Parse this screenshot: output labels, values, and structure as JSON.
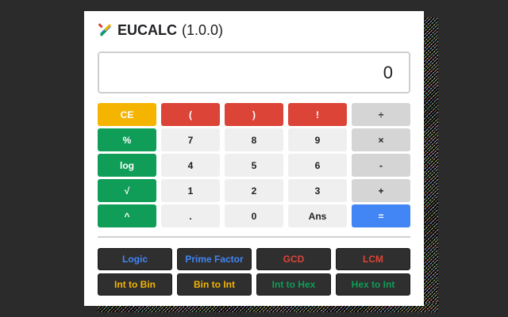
{
  "header": {
    "app_name": "EUCALC",
    "version": "(1.0.0)",
    "logo_icon": "pencil-ruler-icon"
  },
  "display": {
    "value": "0"
  },
  "keypad": {
    "rows": [
      [
        {
          "label": "CE",
          "name": "clear-entry-button",
          "color": "yellow"
        },
        {
          "label": "(",
          "name": "open-paren-button",
          "color": "red"
        },
        {
          "label": ")",
          "name": "close-paren-button",
          "color": "red"
        },
        {
          "label": "!",
          "name": "factorial-button",
          "color": "red"
        },
        {
          "label": "÷",
          "name": "divide-button",
          "color": "gray"
        }
      ],
      [
        {
          "label": "%",
          "name": "percent-button",
          "color": "green"
        },
        {
          "label": "7",
          "name": "digit-7-button",
          "color": "light"
        },
        {
          "label": "8",
          "name": "digit-8-button",
          "color": "light"
        },
        {
          "label": "9",
          "name": "digit-9-button",
          "color": "light"
        },
        {
          "label": "×",
          "name": "multiply-button",
          "color": "gray"
        }
      ],
      [
        {
          "label": "log",
          "name": "log-button",
          "color": "green"
        },
        {
          "label": "4",
          "name": "digit-4-button",
          "color": "light"
        },
        {
          "label": "5",
          "name": "digit-5-button",
          "color": "light"
        },
        {
          "label": "6",
          "name": "digit-6-button",
          "color": "light"
        },
        {
          "label": "-",
          "name": "subtract-button",
          "color": "gray"
        }
      ],
      [
        {
          "label": "√",
          "name": "sqrt-button",
          "color": "green"
        },
        {
          "label": "1",
          "name": "digit-1-button",
          "color": "light"
        },
        {
          "label": "2",
          "name": "digit-2-button",
          "color": "light"
        },
        {
          "label": "3",
          "name": "digit-3-button",
          "color": "light"
        },
        {
          "label": "+",
          "name": "add-button",
          "color": "gray"
        }
      ],
      [
        {
          "label": "^",
          "name": "power-button",
          "color": "green"
        },
        {
          "label": ".",
          "name": "decimal-button",
          "color": "light"
        },
        {
          "label": "0",
          "name": "digit-0-button",
          "color": "light"
        },
        {
          "label": "Ans",
          "name": "answer-button",
          "color": "light"
        },
        {
          "label": "=",
          "name": "equals-button",
          "color": "blue"
        }
      ]
    ]
  },
  "functions": [
    {
      "label": "Logic",
      "name": "logic-button",
      "color": "#4285f4"
    },
    {
      "label": "Prime Factor",
      "name": "prime-factor-button",
      "color": "#4285f4"
    },
    {
      "label": "GCD",
      "name": "gcd-button",
      "color": "#db4437"
    },
    {
      "label": "LCM",
      "name": "lcm-button",
      "color": "#db4437"
    },
    {
      "label": "Int to Bin",
      "name": "int-to-bin-button",
      "color": "#f4b400"
    },
    {
      "label": "Bin to Int",
      "name": "bin-to-int-button",
      "color": "#f4b400"
    },
    {
      "label": "Int to Hex",
      "name": "int-to-hex-button",
      "color": "#0f9d58"
    },
    {
      "label": "Hex to Int",
      "name": "hex-to-int-button",
      "color": "#0f9d58"
    }
  ]
}
